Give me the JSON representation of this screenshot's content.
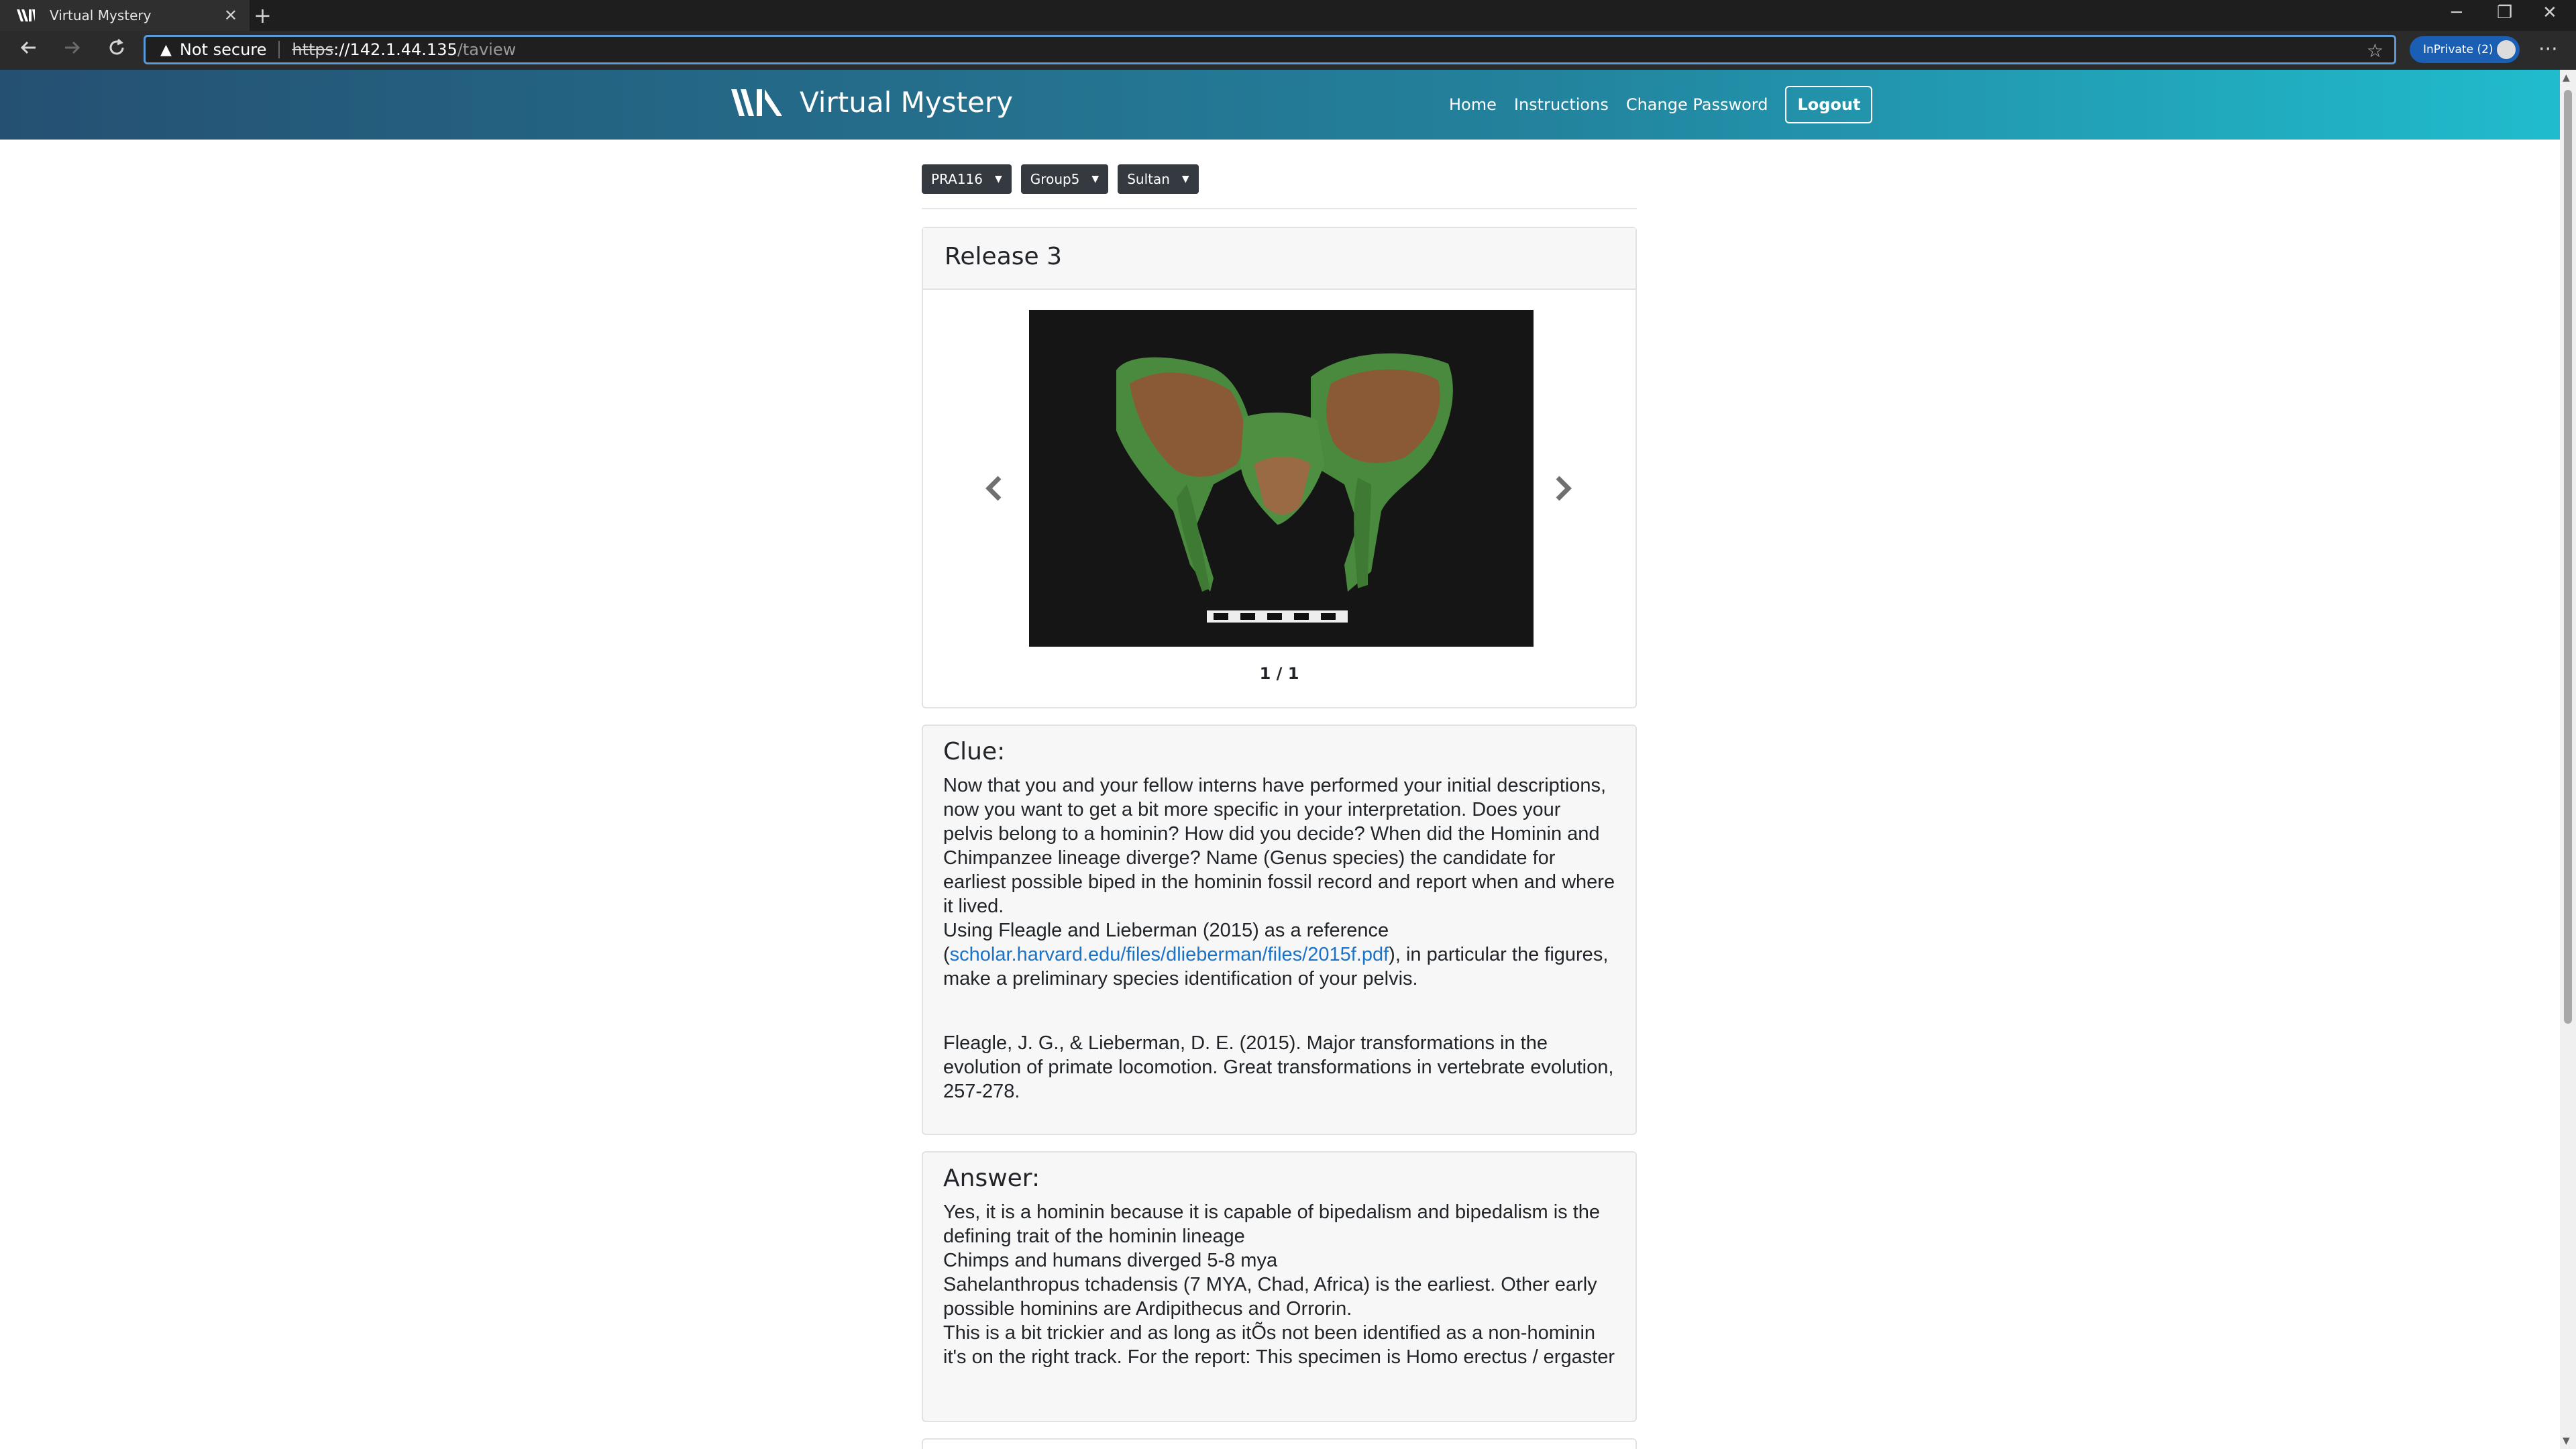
{
  "browser": {
    "tab_title": "Virtual Mystery",
    "new_tab": "+",
    "tab_close": "✕",
    "not_secure": "Not secure",
    "url_scheme": "https",
    "url_host": "://142.1.44.135",
    "url_path": "/taview",
    "inprivate_label": "InPrivate (2)",
    "more": "···",
    "minimize": "─",
    "restore": "❐",
    "close": "✕"
  },
  "site": {
    "brand": "Virtual Mystery",
    "nav": {
      "home": "Home",
      "instructions": "Instructions",
      "change_password": "Change Password",
      "logout": "Logout"
    },
    "header_gradient": [
      "#255072",
      "#23829d",
      "#20bccd"
    ]
  },
  "filters": {
    "course": "PRA116",
    "group": "Group5",
    "student": "Sultan"
  },
  "release": {
    "title": "Release 3",
    "counter": "1 / 1"
  },
  "clue": {
    "heading": "Clue:",
    "text_before_link": "Now that you and your fellow interns have performed your initial descriptions, now you want to get a bit more specific in your interpretation. Does your pelvis belong to a hominin? How did you decide? When did the Hominin and Chimpanzee lineage diverge? Name (Genus species) the candidate for earliest possible biped in the hominin fossil record and report when and where it lived.",
    "reference_intro": "Using Fleagle and Lieberman (2015) as a reference (",
    "link": "scholar.harvard.edu/files/dlieberman/files/2015f.pdf",
    "text_after_link": "), in particular the figures, make a preliminary species identification of your pelvis.",
    "citation": "Fleagle, J. G., & Lieberman, D. E. (2015). Major transformations in the evolution of primate locomotion. Great transformations in vertebrate evolution, 257-278."
  },
  "answer": {
    "heading": "Answer:",
    "line1": "Yes, it is a hominin because it is capable of bipedalism and bipedalism is the defining trait of the hominin lineage",
    "line2": "Chimps and humans diverged 5-8 mya",
    "line3": "Sahelanthropus tchadensis (7 MYA, Chad, Africa) is the earliest. Other early possible hominins are Ardipithecus and Orrorin.",
    "line4": "This is a bit trickier and as long as itÕs not been identified as a non-hominin it's on the right track. For the report: This specimen is Homo erectus / ergaster"
  },
  "icons": {
    "back": "back-arrow-icon",
    "forward": "forward-arrow-icon",
    "reload": "reload-icon",
    "warning": "warning-icon",
    "favorite": "star-icon",
    "prev": "chevron-left-icon",
    "next": "chevron-right-icon",
    "caret": "caret-down-icon"
  }
}
